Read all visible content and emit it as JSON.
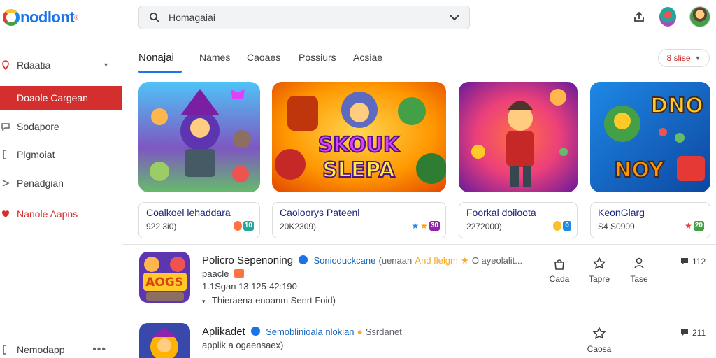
{
  "app": {
    "logo_text": "nodlont",
    "logo_first": "G",
    "logo_mark": "®"
  },
  "sidebar": {
    "items": [
      {
        "label": "Rdaatia",
        "icon": "map-pin-icon",
        "has_caret": true
      },
      {
        "label": "Doaole Cargean",
        "icon": "",
        "active": true
      },
      {
        "label": "Sodapore",
        "icon": "chat-icon"
      },
      {
        "label": "Plgmoiat",
        "icon": "bracket-icon"
      },
      {
        "label": "Penadgian",
        "icon": "arrow-icon"
      },
      {
        "label": "Nanole Aapns",
        "icon": "heart-icon",
        "red": true
      }
    ],
    "bottom": {
      "label": "Nemodapp",
      "more": "•••"
    }
  },
  "search": {
    "value": "Homagaiai"
  },
  "tabs": [
    {
      "label": "Nonajai",
      "active": true
    },
    {
      "label": "Names"
    },
    {
      "label": "Caoaes"
    },
    {
      "label": "Possiurs"
    },
    {
      "label": "Acsiae"
    }
  ],
  "filter": {
    "label": "8 slise"
  },
  "cards": [
    {
      "title": "Coalkoel lehaddara",
      "meta": "922 3i0)",
      "badges": [
        "●",
        "10"
      ]
    },
    {
      "title": "Caoloorys Pateenl",
      "meta": "20K2309)",
      "badges": [
        "★",
        "★",
        "30"
      ]
    },
    {
      "title": "Foorkal doiloota",
      "meta": "2272000)",
      "badges": [
        "●",
        "0"
      ]
    },
    {
      "title": "KeonGlarg",
      "meta": "S4 S0909",
      "badges": [
        "★",
        "20"
      ]
    }
  ],
  "card_art": [
    {
      "banner": "",
      "colors": [
        "#4fc3f7",
        "#7e57c2",
        "#66bb6a"
      ]
    },
    {
      "banner": "SKOUK SLEPA",
      "colors": [
        "#ff9800",
        "#e65100",
        "#ffd54f"
      ]
    },
    {
      "banner": "",
      "colors": [
        "#ec407a",
        "#6a1b9a",
        "#ff7043"
      ]
    },
    {
      "banner": "DNO NOY",
      "colors": [
        "#1e88e5",
        "#0d47a1",
        "#43a047"
      ]
    }
  ],
  "rows": [
    {
      "title": "Policro Sepenoning",
      "dev": "Sonioduckcane",
      "tag": "(uenaan",
      "highlight": "And Ilelgm",
      "extra": "O ayeolalit...",
      "line1": "paacle",
      "line2": "1.1Sgan  13 125-42:190",
      "line3": "Thieraena enoanm Senrt  Foid)",
      "thumb_text": "AOGS",
      "actions": [
        {
          "label": "Cada",
          "icon": "bag-icon"
        },
        {
          "label": "Tapre",
          "icon": "star-outline-icon"
        },
        {
          "label": "Tase",
          "icon": "person-icon"
        }
      ],
      "count": "112"
    },
    {
      "title": "Aplikadet",
      "dev": "Semoblinioala nlokian",
      "tag": "Ssrdanet",
      "line1": "applik a ogaensaex)",
      "actions": [
        {
          "label": "Caosa",
          "icon": "star-outline-icon"
        }
      ],
      "count": "211"
    }
  ],
  "colors": {
    "accent": "#d32f2f",
    "link": "#1a73e8",
    "card_title": "#1a237e"
  }
}
